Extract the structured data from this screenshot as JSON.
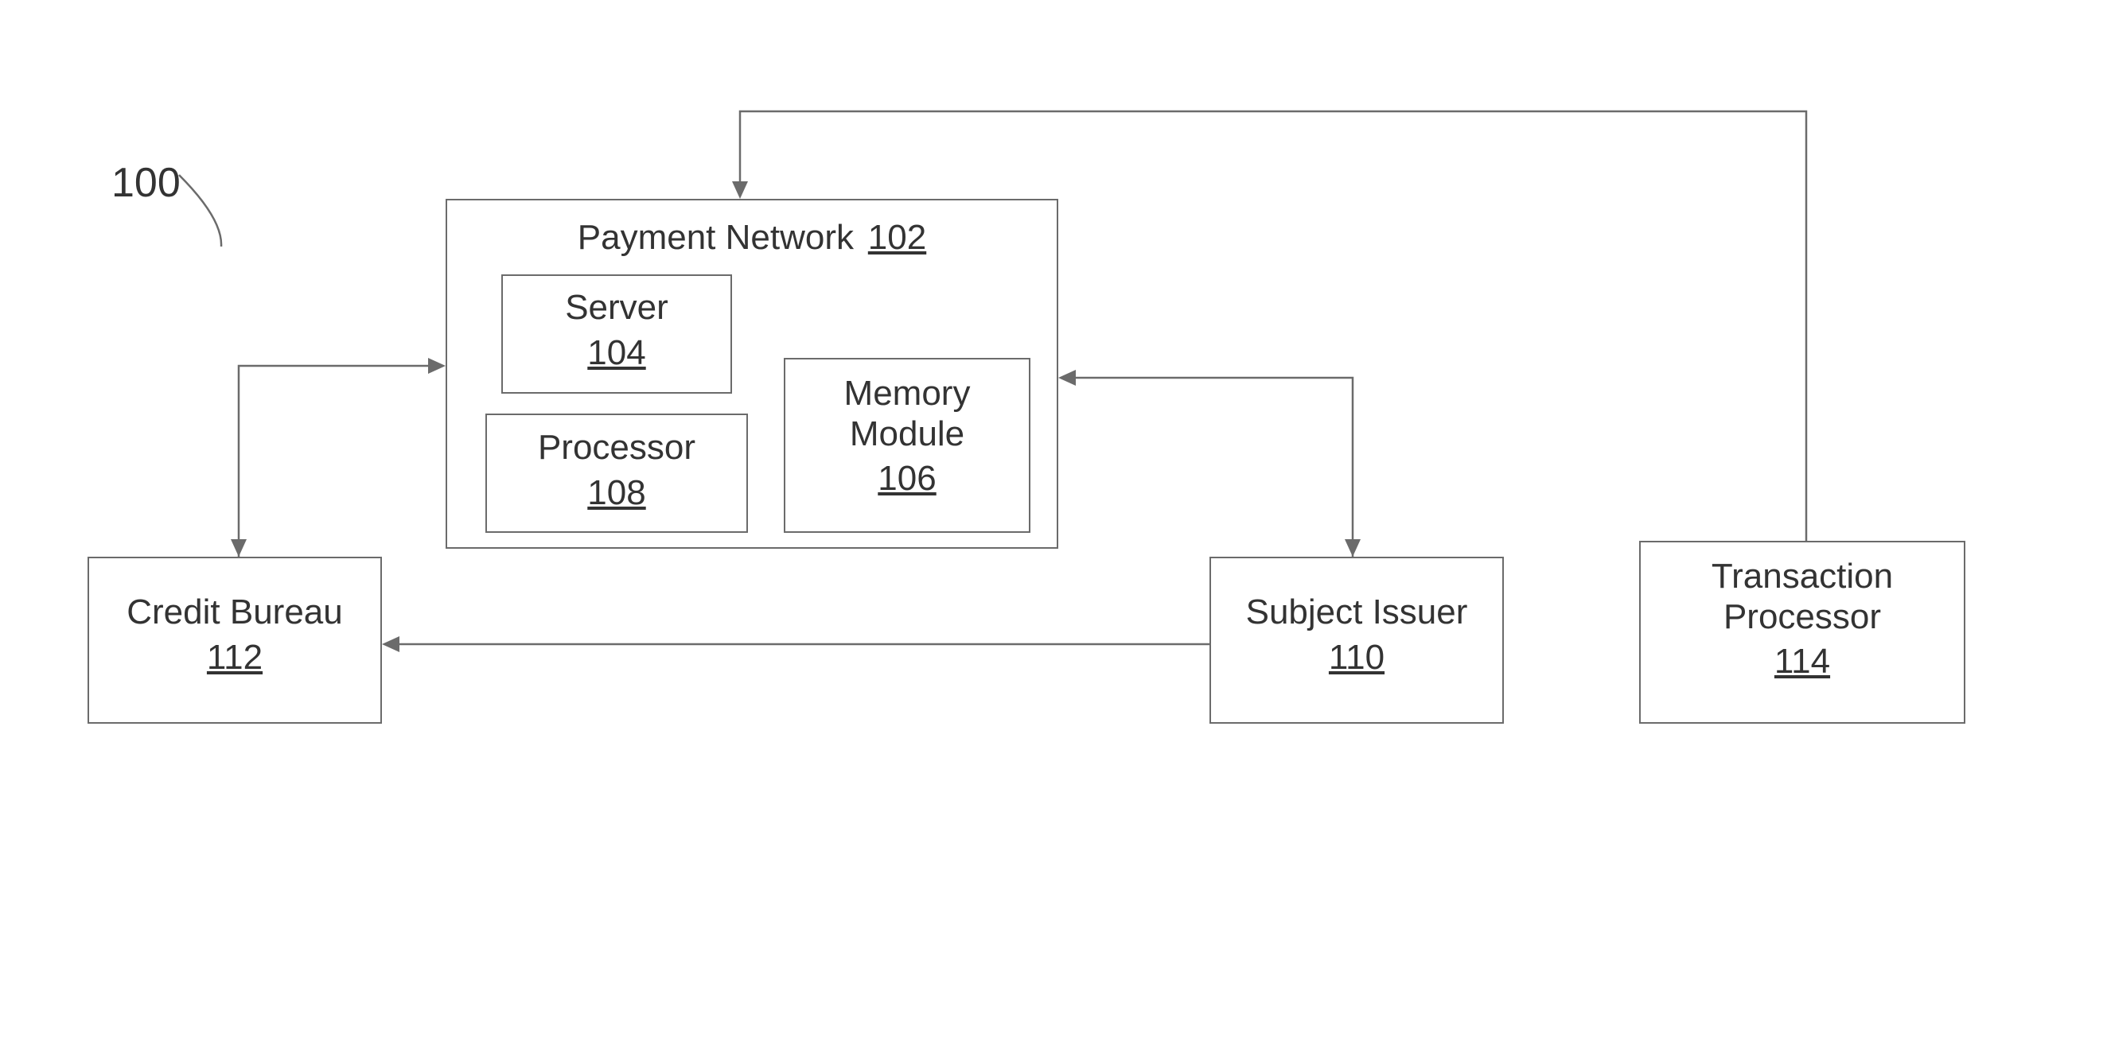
{
  "figure": {
    "number": "100"
  },
  "paymentNetwork": {
    "title": "Payment Network",
    "ref": "102"
  },
  "server": {
    "title": "Server",
    "ref": "104"
  },
  "memoryModule": {
    "title1": "Memory",
    "title2": "Module",
    "ref": "106"
  },
  "processor": {
    "title": "Processor",
    "ref": "108"
  },
  "subjectIssuer": {
    "title": "Subject Issuer",
    "ref": "110"
  },
  "creditBureau": {
    "title": "Credit Bureau",
    "ref": "112"
  },
  "txProcessor": {
    "title1": "Transaction",
    "title2": "Processor",
    "ref": "114"
  }
}
